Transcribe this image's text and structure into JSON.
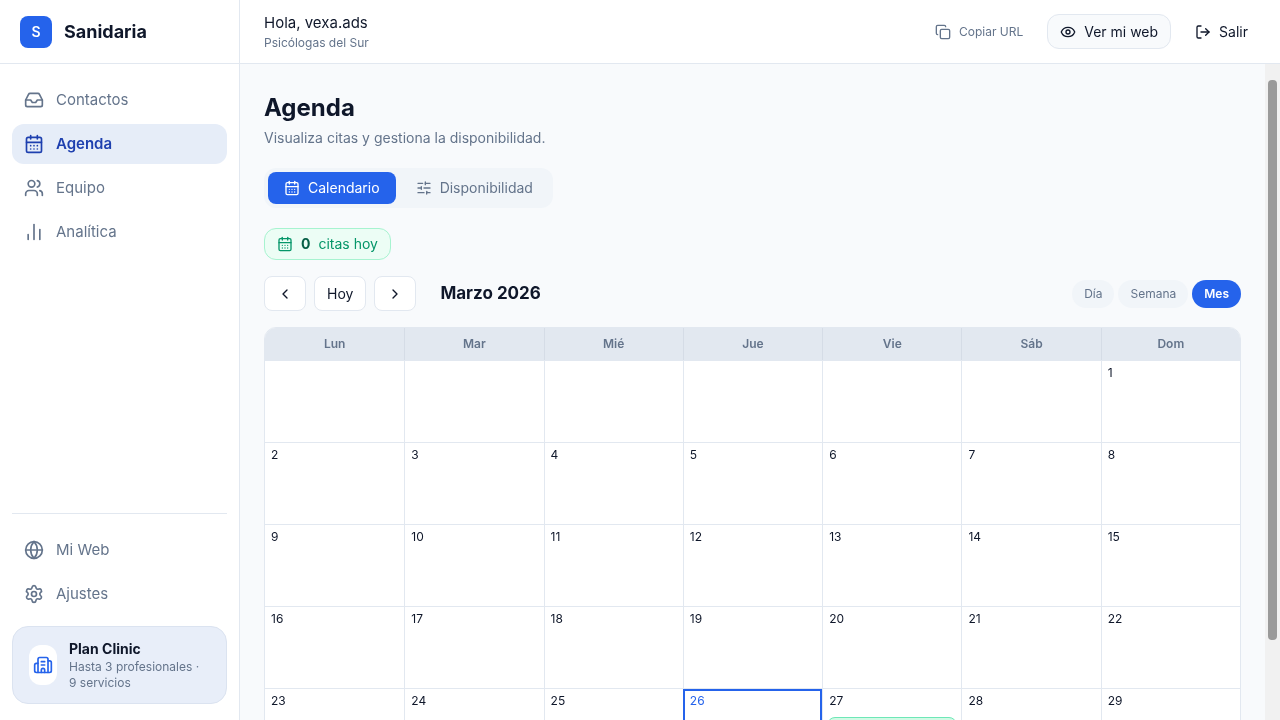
{
  "brand": {
    "logo": "S",
    "name": "Sanidaria"
  },
  "nav": [
    {
      "label": "Contactos",
      "kind": "inbox",
      "selected": false
    },
    {
      "label": "Agenda",
      "kind": "calendar",
      "selected": true
    },
    {
      "label": "Equipo",
      "kind": "users",
      "selected": false
    },
    {
      "label": "Analítica",
      "kind": "chart",
      "selected": false
    }
  ],
  "nav_bottom": [
    {
      "label": "Mi Web",
      "kind": "globe",
      "selected": false
    },
    {
      "label": "Ajustes",
      "kind": "gear",
      "selected": false
    }
  ],
  "plan": {
    "name": "Plan Clinic",
    "detail": "Hasta 3 profesionales · 9 servicios"
  },
  "header": {
    "greeting": "Hola, vexa.ads",
    "org": "Psicólogas del Sur",
    "copy": "Copiar URL",
    "view": "Ver mi web",
    "logout": "Salir"
  },
  "page": {
    "title": "Agenda",
    "subtitle": "Visualiza citas y gestiona la disponibilidad."
  },
  "tabs": [
    {
      "label": "Calendario",
      "kind": "calendar",
      "selected": true
    },
    {
      "label": "Disponibilidad",
      "kind": "sliders",
      "selected": false
    }
  ],
  "today_badge": {
    "count": "0",
    "label": "citas hoy"
  },
  "toolbar": {
    "today": "Hoy",
    "month": "Marzo 2026"
  },
  "views": [
    {
      "label": "Día",
      "selected": false
    },
    {
      "label": "Semana",
      "selected": false
    },
    {
      "label": "Mes",
      "selected": true
    }
  ],
  "weekdays": [
    "Lun",
    "Mar",
    "Mié",
    "Jue",
    "Vie",
    "Sáb",
    "Dom"
  ],
  "weeks": [
    [
      {
        "kind": "blank"
      },
      {
        "kind": "blank"
      },
      {
        "kind": "blank"
      },
      {
        "kind": "blank"
      },
      {
        "kind": "blank"
      },
      {
        "kind": "blank"
      },
      {
        "kind": "day",
        "day": "1",
        "today": false,
        "event": false
      }
    ],
    [
      {
        "kind": "day",
        "day": "2",
        "today": false,
        "event": false
      },
      {
        "kind": "day",
        "day": "3",
        "today": false,
        "event": false
      },
      {
        "kind": "day",
        "day": "4",
        "today": false,
        "event": false
      },
      {
        "kind": "day",
        "day": "5",
        "today": false,
        "event": false
      },
      {
        "kind": "day",
        "day": "6",
        "today": false,
        "event": false
      },
      {
        "kind": "day",
        "day": "7",
        "today": false,
        "event": false
      },
      {
        "kind": "day",
        "day": "8",
        "today": false,
        "event": false
      }
    ],
    [
      {
        "kind": "day",
        "day": "9",
        "today": false,
        "event": false
      },
      {
        "kind": "day",
        "day": "10",
        "today": false,
        "event": false
      },
      {
        "kind": "day",
        "day": "11",
        "today": false,
        "event": false
      },
      {
        "kind": "day",
        "day": "12",
        "today": false,
        "event": false
      },
      {
        "kind": "day",
        "day": "13",
        "today": false,
        "event": false
      },
      {
        "kind": "day",
        "day": "14",
        "today": false,
        "event": false
      },
      {
        "kind": "day",
        "day": "15",
        "today": false,
        "event": false
      }
    ],
    [
      {
        "kind": "day",
        "day": "16",
        "today": false,
        "event": false
      },
      {
        "kind": "day",
        "day": "17",
        "today": false,
        "event": false
      },
      {
        "kind": "day",
        "day": "18",
        "today": false,
        "event": false
      },
      {
        "kind": "day",
        "day": "19",
        "today": false,
        "event": false
      },
      {
        "kind": "day",
        "day": "20",
        "today": false,
        "event": false
      },
      {
        "kind": "day",
        "day": "21",
        "today": false,
        "event": false
      },
      {
        "kind": "day",
        "day": "22",
        "today": false,
        "event": false
      }
    ],
    [
      {
        "kind": "day",
        "day": "23",
        "today": false,
        "event": false
      },
      {
        "kind": "day",
        "day": "24",
        "today": false,
        "event": false
      },
      {
        "kind": "day",
        "day": "25",
        "today": false,
        "event": false
      },
      {
        "kind": "day",
        "day": "26",
        "today": true,
        "event": false
      },
      {
        "kind": "day",
        "day": "27",
        "today": false,
        "event": true
      },
      {
        "kind": "day",
        "day": "28",
        "today": false,
        "event": false
      },
      {
        "kind": "day",
        "day": "29",
        "today": false,
        "event": false
      }
    ]
  ]
}
